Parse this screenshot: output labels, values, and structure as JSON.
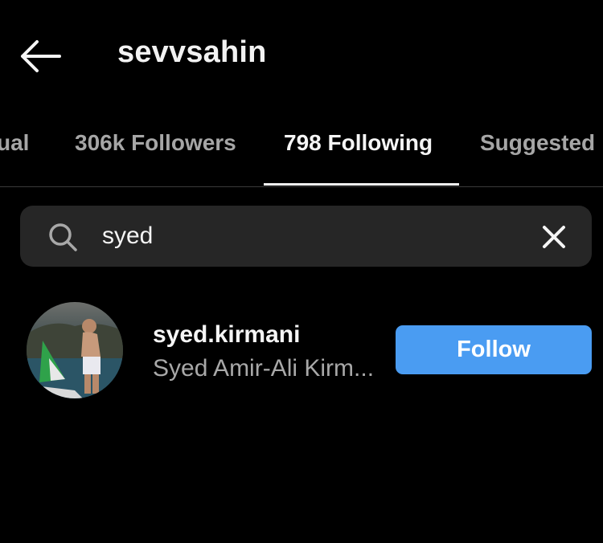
{
  "header": {
    "title": "sevvsahin",
    "back_icon": "arrow-left-icon"
  },
  "tabs": [
    {
      "label": "ual",
      "active": false
    },
    {
      "label": "306k Followers",
      "active": false
    },
    {
      "label": "798 Following",
      "active": true
    },
    {
      "label": "Suggested",
      "active": false
    }
  ],
  "search": {
    "value": "syed",
    "icon": "search-icon",
    "clear_icon": "close-icon"
  },
  "results": [
    {
      "username": "syed.kirmani",
      "full_name": "Syed Amir-Ali Kirm...",
      "follow_label": "Follow"
    }
  ],
  "colors": {
    "background": "#000000",
    "search_bg": "#262626",
    "follow_button": "#4a9cf2",
    "secondary_text": "#a8a8a8"
  }
}
